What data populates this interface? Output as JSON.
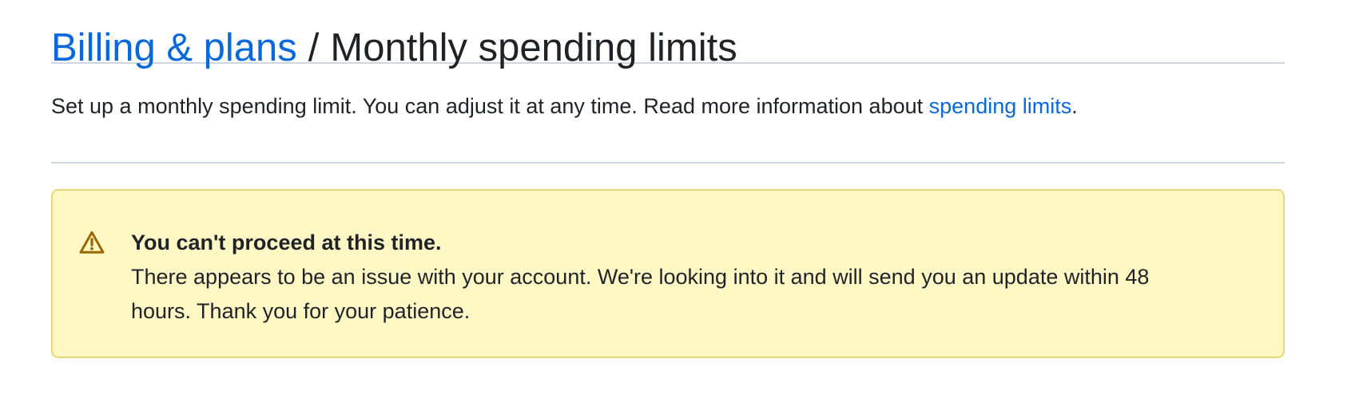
{
  "header": {
    "breadcrumb_link": "Billing & plans",
    "separator": "/",
    "current_page": "Monthly spending limits"
  },
  "description": {
    "text": "Set up a monthly spending limit. You can adjust it at any time. Read more information about ",
    "link_label": "spending limits",
    "suffix": "."
  },
  "flash": {
    "icon": "alert-triangle-icon",
    "title": "You can't proceed at this time.",
    "message": "There appears to be an issue with your account. We're looking into it and will send you an update within 48 hours. Thank you for your patience."
  },
  "colors": {
    "link": "#0969da",
    "text": "#1f2328",
    "divider": "#d0d7de",
    "warning_bg": "#fff8c5",
    "warning_border": "#e9d57a",
    "warning_icon": "#9a6700"
  }
}
